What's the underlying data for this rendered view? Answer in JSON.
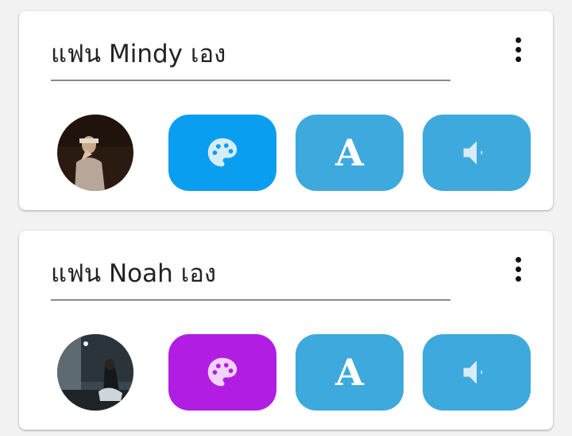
{
  "cards": [
    {
      "title": "แฟน Mindy เอง",
      "avatar_icon": "user-photo",
      "palette_color": "#0a9ef0",
      "palette_icon": "palette-icon",
      "font_label": "A",
      "font_icon": "font-icon",
      "sound_icon": "speaker-icon",
      "menu_icon": "more-vert-icon"
    },
    {
      "title": "แฟน Noah เอง",
      "avatar_icon": "user-photo",
      "palette_color": "#b21de3",
      "palette_icon": "palette-icon",
      "font_label": "A",
      "font_icon": "font-icon",
      "sound_icon": "speaker-icon",
      "menu_icon": "more-vert-icon"
    }
  ],
  "colors": {
    "action_blue": "#3ea9dd",
    "icon_tint": "#d6edf8"
  }
}
